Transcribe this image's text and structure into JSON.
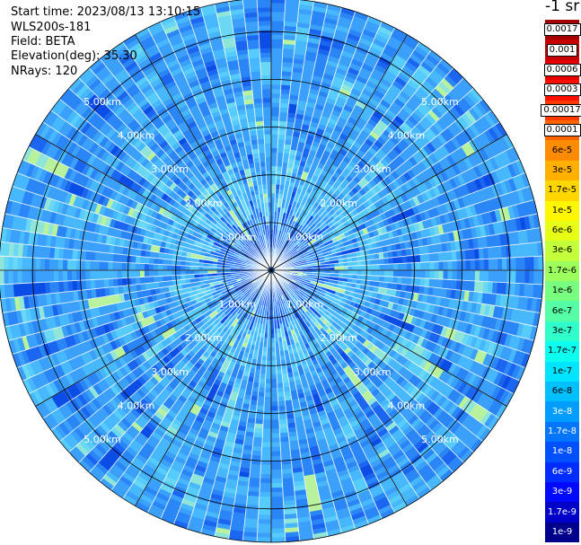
{
  "info": {
    "start_time": "Start time: 2023/08/13 13:10:15",
    "instrument": "WLS200s-181",
    "field": "Field: BETA",
    "elevation": "Elevation(deg): 35.30",
    "nrays": "NRays: 120"
  },
  "colorbar": {
    "unit": "-1 sr",
    "levels": [
      {
        "label": "0.0017",
        "color": "#a50000",
        "boxed": true
      },
      {
        "label": "0.001",
        "color": "#c80000",
        "boxed": true
      },
      {
        "label": "0.0006",
        "color": "#e60000",
        "boxed": true
      },
      {
        "label": "0.0003",
        "color": "#ff0f00",
        "boxed": true
      },
      {
        "label": "0.00017",
        "color": "#ff3a00",
        "boxed": true
      },
      {
        "label": "0.0001",
        "color": "#ff6400",
        "boxed": true
      },
      {
        "label": "6e-5",
        "color": "#ff8c00",
        "boxed": false
      },
      {
        "label": "3e-5",
        "color": "#ffb000",
        "boxed": false
      },
      {
        "label": "1.7e-5",
        "color": "#ffd600",
        "boxed": false
      },
      {
        "label": "1e-5",
        "color": "#fff700",
        "boxed": false
      },
      {
        "label": "6e-6",
        "color": "#e6ff14",
        "boxed": false
      },
      {
        "label": "3e-6",
        "color": "#c3ff3a",
        "boxed": false
      },
      {
        "label": "1.7e-6",
        "color": "#9dff5e",
        "boxed": false
      },
      {
        "label": "1e-6",
        "color": "#79ff80",
        "boxed": false
      },
      {
        "label": "6e-7",
        "color": "#55ffa6",
        "boxed": false
      },
      {
        "label": "3e-7",
        "color": "#30ffcb",
        "boxed": false
      },
      {
        "label": "1.7e-7",
        "color": "#0dfff0",
        "boxed": false
      },
      {
        "label": "1e-7",
        "color": "#00e4ff",
        "boxed": false
      },
      {
        "label": "6e-8",
        "color": "#00c0ff",
        "boxed": false
      },
      {
        "label": "3e-8",
        "color": "#009cff",
        "boxed": false
      },
      {
        "label": "1.7e-8",
        "color": "#0076ff",
        "boxed": false
      },
      {
        "label": "1e-8",
        "color": "#0050ff",
        "boxed": false
      },
      {
        "label": "6e-9",
        "color": "#002cff",
        "boxed": false
      },
      {
        "label": "3e-9",
        "color": "#0008ff",
        "boxed": false
      },
      {
        "label": "1.7e-9",
        "color": "#0000c8",
        "boxed": false
      },
      {
        "label": "1e-9",
        "color": "#00008c",
        "boxed": false
      }
    ]
  },
  "chart_data": {
    "type": "heatmap",
    "projection": "polar PPI scan",
    "field": "BETA",
    "elevation_deg": 35.3,
    "n_rays": 120,
    "ring_labels": [
      "1.00km",
      "2.00km",
      "3.00km",
      "4.00km",
      "5.00km"
    ],
    "ring_ranges_km": [
      1,
      2,
      3,
      4,
      5
    ],
    "max_range_km": 5.7,
    "spoke_angles_deg": [
      0,
      30,
      60,
      90,
      120,
      150,
      180,
      210,
      240,
      270,
      300,
      330
    ],
    "dominant_value_range": [
      "1.7e-8",
      "1.7e-7"
    ],
    "notes": "Backscatter field fills the disk; mostly blue/cyan values with scattered light-green and yellow-green patches."
  }
}
